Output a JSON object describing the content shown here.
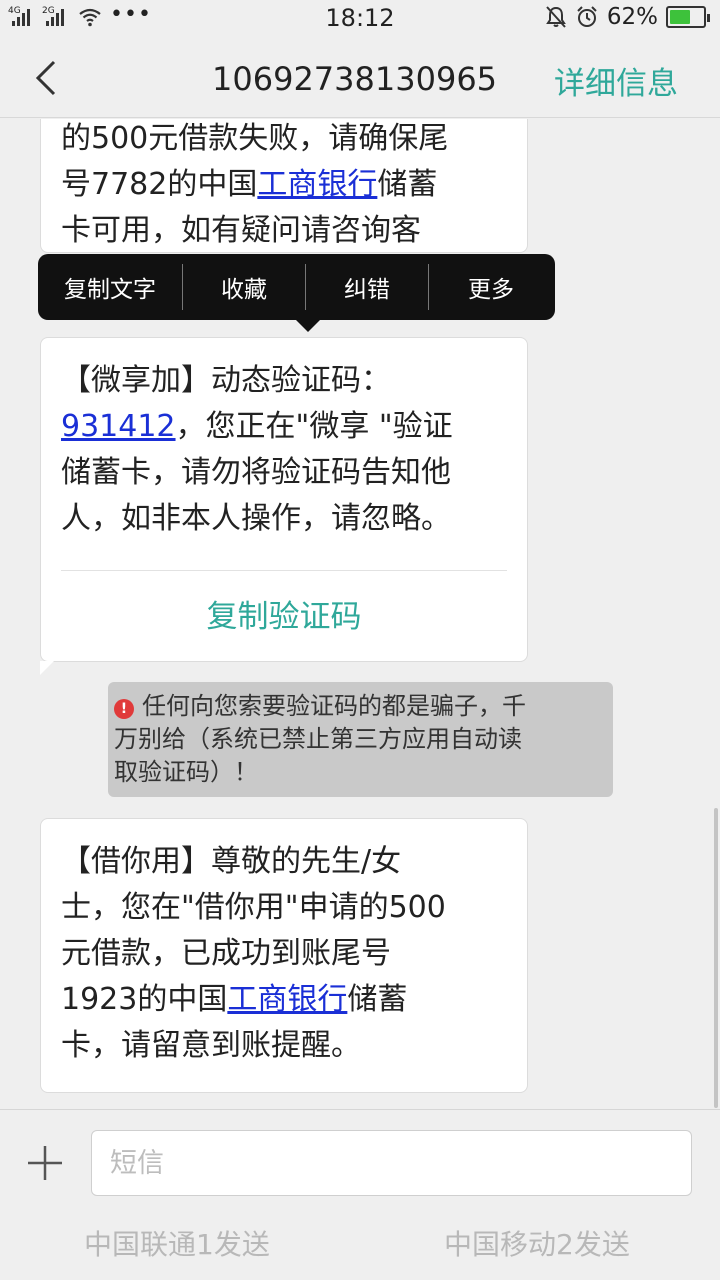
{
  "status_bar": {
    "net1": "4G",
    "net2": "2G",
    "more": "•••",
    "time": "18:12",
    "battery_text": "62%",
    "battery_level": 0.62
  },
  "header": {
    "title": "10692738130965",
    "detail_label": "详细信息"
  },
  "context_menu": {
    "items": [
      "复制文字",
      "收藏",
      "纠错",
      "更多"
    ]
  },
  "messages": [
    {
      "line1": "的500元借款失败，请确保尾",
      "line2_pre": "号7782的中国",
      "line2_link": "工商银行",
      "line2_post": "储蓄",
      "line3": "卡可用，如有疑问请咨询客"
    },
    {
      "line1": "【微享加】动态验证码：",
      "line2_link": "931412",
      "line2_post": "，您正在\"微享 \"验证",
      "line3": "储蓄卡，请勿将验证码告知他",
      "line4": "人，如非本人操作，请忽略。",
      "copy_label": "复制验证码"
    },
    {
      "line1": "【借你用】尊敬的先生/女",
      "line2": "士，您在\"借你用\"申请的500",
      "line3": "元借款，已成功到账尾号",
      "line4_pre": "1923的中国",
      "line4_link": "工商银行",
      "line4_post": "储蓄",
      "line5": "卡，请留意到账提醒。"
    }
  ],
  "warning": {
    "icon": "!",
    "line1": "任何向您索要验证码的都是骗子，千",
    "line2": "万别给（系统已禁止第三方应用自动读",
    "line3": "取验证码）！"
  },
  "composer": {
    "placeholder": "短信",
    "send1": "中国联通1发送",
    "send2": "中国移动2发送"
  },
  "colors": {
    "accent": "#2fa89a",
    "link": "#1a2fd6",
    "warning_red": "#e03a3a",
    "battery_green": "#3dc23b"
  }
}
